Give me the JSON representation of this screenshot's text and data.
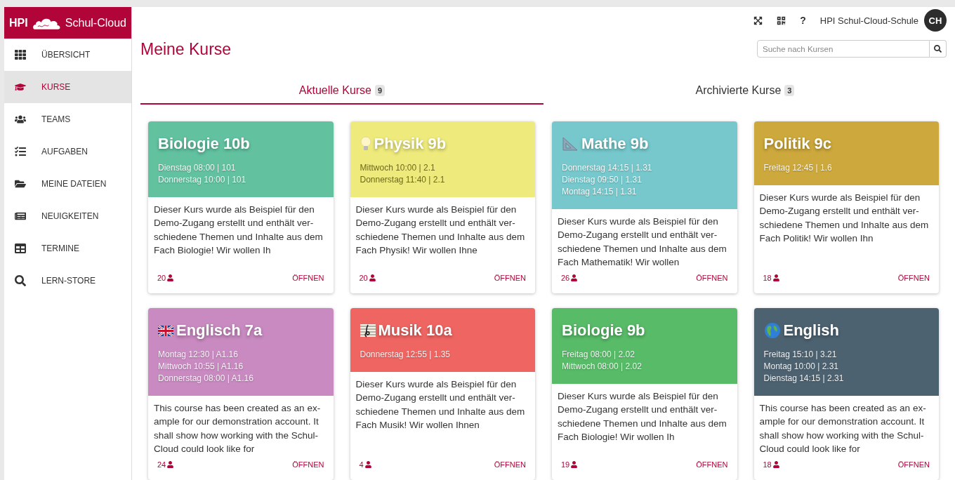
{
  "sidebar": {
    "logo": {
      "prefix": "HPI",
      "name": "Schul-Cloud"
    },
    "items": [
      {
        "label": "ÜBERSICHT",
        "selected": false
      },
      {
        "label": "KURSE",
        "selected": true
      },
      {
        "label": "TEAMS",
        "selected": false
      },
      {
        "label": "AUFGABEN",
        "selected": false
      },
      {
        "label": "MEINE DATEIEN",
        "selected": false
      },
      {
        "label": "NEUIGKEITEN",
        "selected": false
      },
      {
        "label": "TERMINE",
        "selected": false
      },
      {
        "label": "LERN-STORE",
        "selected": false
      }
    ]
  },
  "topbar": {
    "help": "?",
    "school": "HPI Schul-Cloud-Schule",
    "avatar": "CH"
  },
  "page_title": "Meine Kurse",
  "search": {
    "placeholder": "Suche nach Kursen"
  },
  "tabs": [
    {
      "label": "Aktuelle Kurse",
      "count": "9",
      "selected": true
    },
    {
      "label": "Archivierte Kurse",
      "count": "3",
      "selected": false
    }
  ],
  "courses": [
    {
      "title": "Biologie 10b",
      "color": "#62c2a0",
      "schedule": [
        "Dienstag 08:00 | 101",
        "Donnerstag 10:00 | 101"
      ],
      "description": [
        "Dieser Kurs wurde als Beispiel für den",
        "Demo-Zugang erstellt und enthält ver-",
        "schiedene Themen und Inhalte aus dem",
        "Fach Biologie! Wir wollen Ih"
      ],
      "members": "20",
      "action": "ÖFFNEN"
    },
    {
      "title": "Physik 9b",
      "color": "#eeea7c",
      "schedule": [
        "Mittwoch 10:00 | 2.1",
        "Donnerstag 11:40 | 2.1"
      ],
      "description": [
        "Dieser Kurs wurde als Beispiel für den",
        "Demo-Zugang erstellt und enthält ver-",
        "schiedene Themen und Inhalte aus dem",
        "Fach Physik! Wir wollen Ihne"
      ],
      "members": "20",
      "action": "ÖFFNEN"
    },
    {
      "title": "Mathe 9b",
      "color": "#76c8cc",
      "schedule": [
        "Donnerstag 14:15 | 1.31",
        "Dienstag 09:50 | 1.31",
        "Montag 14:15 | 1.31"
      ],
      "description": [
        "Dieser Kurs wurde als Beispiel für den",
        "Demo-Zugang erstellt und enthält ver-",
        "schiedene Themen und Inhalte aus dem",
        "Fach Mathematik! Wir wollen"
      ],
      "members": "26",
      "action": "ÖFFNEN"
    },
    {
      "title": "Politik 9c",
      "color": "#cda83c",
      "schedule": [
        "Freitag 12:45 | 1.6"
      ],
      "description": [
        "Dieser Kurs wurde als Beispiel für den",
        "Demo-Zugang erstellt und enthält ver-",
        "schiedene Themen und Inhalte aus dem",
        "Fach Politik! Wir wollen Ihn"
      ],
      "members": "18",
      "action": "ÖFFNEN"
    },
    {
      "title": "Englisch 7a",
      "color": "#c88ac0",
      "schedule": [
        "Montag 12:30 | A1.16",
        "Mittwoch 10:55 | A1.16",
        "Donnerstag 08:00 | A1.16"
      ],
      "description": [
        "This course has been created as an ex-",
        "ample for our demonstration account. It",
        "shall show how working with the Schul-",
        "Cloud could look like for"
      ],
      "members": "24",
      "action": "ÖFFNEN"
    },
    {
      "title": "Musik 10a",
      "color": "#ef6562",
      "schedule": [
        "Donnerstag 12:55 | 1.35"
      ],
      "description": [
        "Dieser Kurs wurde als Beispiel für den",
        "Demo-Zugang erstellt und enthält ver-",
        "schiedene Themen und Inhalte aus dem",
        "Fach Musik! Wir wollen Ihnen"
      ],
      "members": "4",
      "action": "ÖFFNEN"
    },
    {
      "title": "Biologie 9b",
      "color": "#58bb68",
      "schedule": [
        "Freitag 08:00 | 2.02",
        "Mittwoch 08:00 | 2.02"
      ],
      "description": [
        "Dieser Kurs wurde als Beispiel für den",
        "Demo-Zugang erstellt und enthält ver-",
        "schiedene Themen und Inhalte aus dem",
        "Fach Biologie! Wir wollen Ih"
      ],
      "members": "19",
      "action": "ÖFFNEN"
    },
    {
      "title": "English",
      "color": "#4d6270",
      "schedule": [
        "Freitag 15:10 | 3.21",
        "Montag 10:00 | 2.31",
        "Dienstag 14:15 | 2.31"
      ],
      "description": [
        "This course has been created as an ex-",
        "ample for our demonstration account. It",
        "shall show how working with the Schul-",
        "Cloud could look like for"
      ],
      "members": "18",
      "action": "ÖFFNEN"
    }
  ]
}
